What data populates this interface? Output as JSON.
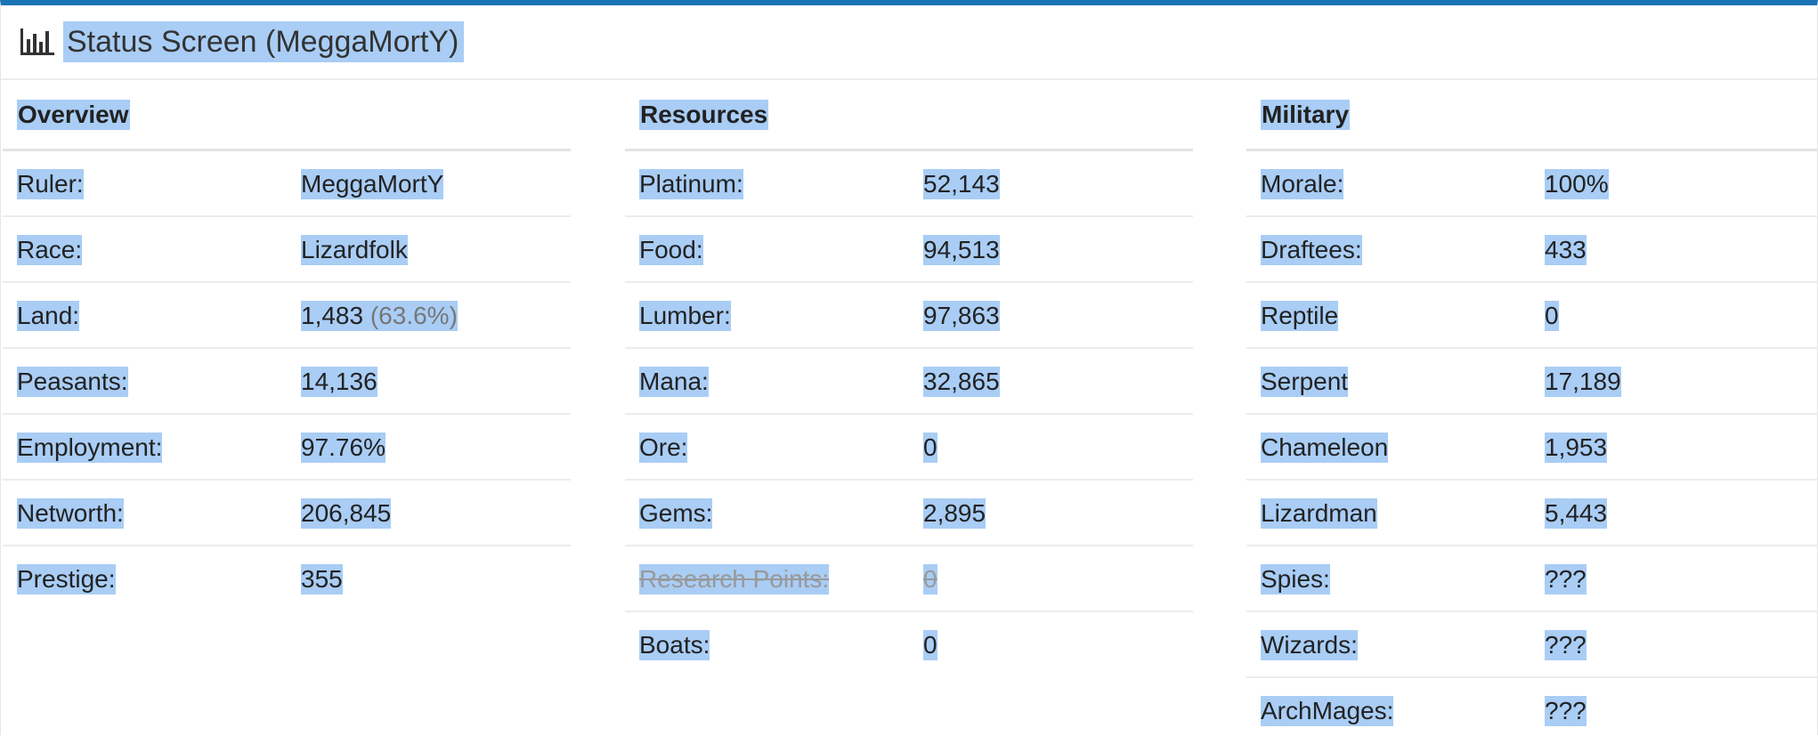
{
  "header": {
    "title": "Status Screen (MeggaMortY)",
    "icon": "bar-chart-icon"
  },
  "colors": {
    "accent": "#1a73b4",
    "selection": "#a9cdf5"
  },
  "overview": {
    "heading": "Overview",
    "rows": [
      {
        "label": "Ruler:",
        "value": "MeggaMortY"
      },
      {
        "label": "Race:",
        "value": "Lizardfolk"
      },
      {
        "label": "Land:",
        "value": "1,483",
        "extra": "(63.6%)"
      },
      {
        "label": "Peasants:",
        "value": "14,136"
      },
      {
        "label": "Employment:",
        "value": "97.76%"
      },
      {
        "label": "Networth:",
        "value": "206,845"
      },
      {
        "label": "Prestige:",
        "value": "355"
      }
    ]
  },
  "resources": {
    "heading": "Resources",
    "rows": [
      {
        "label": "Platinum:",
        "value": "52,143"
      },
      {
        "label": "Food:",
        "value": "94,513"
      },
      {
        "label": "Lumber:",
        "value": "97,863"
      },
      {
        "label": "Mana:",
        "value": "32,865"
      },
      {
        "label": "Ore:",
        "value": "0"
      },
      {
        "label": "Gems:",
        "value": "2,895"
      },
      {
        "label": "Research Points:",
        "value": "0"
      },
      {
        "label": "Boats:",
        "value": "0"
      }
    ]
  },
  "military": {
    "heading": "Military",
    "rows": [
      {
        "label": "Morale:",
        "value": "100%"
      },
      {
        "label": "Draftees:",
        "value": "433"
      },
      {
        "label": "Reptile",
        "value": "0"
      },
      {
        "label": "Serpent",
        "value": "17,189"
      },
      {
        "label": "Chameleon",
        "value": "1,953"
      },
      {
        "label": "Lizardman",
        "value": "5,443"
      },
      {
        "label": "Spies:",
        "value": "???"
      },
      {
        "label": "Wizards:",
        "value": "???"
      },
      {
        "label": "ArchMages:",
        "value": "???"
      }
    ]
  }
}
